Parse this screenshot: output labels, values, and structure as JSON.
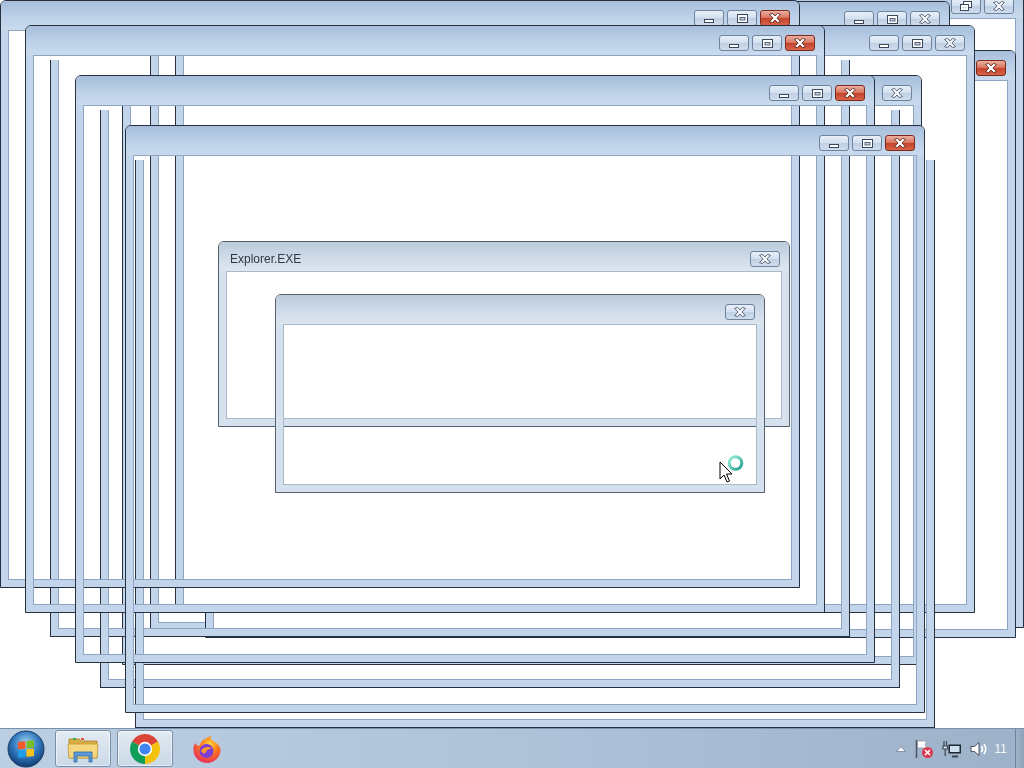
{
  "desktop": {
    "windows": [
      {
        "kind": "window",
        "active": false,
        "buttons": [
          {
            "kind": "restore"
          },
          {
            "kind": "close"
          }
        ]
      },
      {
        "kind": "window",
        "active": false,
        "buttons": [
          {
            "kind": "minimize"
          },
          {
            "kind": "maximize"
          },
          {
            "kind": "close"
          }
        ]
      },
      {
        "kind": "window",
        "active": true,
        "buttons": [
          {
            "kind": "close"
          }
        ]
      },
      {
        "kind": "window",
        "active": false,
        "buttons": [
          {
            "kind": "minimize"
          },
          {
            "kind": "maximize"
          },
          {
            "kind": "close"
          }
        ]
      },
      {
        "kind": "window",
        "active": false,
        "buttons": [
          {
            "kind": "close"
          }
        ]
      },
      {
        "kind": "frame"
      },
      {
        "kind": "frame"
      },
      {
        "kind": "frame"
      },
      {
        "kind": "window",
        "active": true,
        "buttons": [
          {
            "kind": "minimize"
          },
          {
            "kind": "maximize"
          },
          {
            "kind": "close"
          }
        ]
      },
      {
        "kind": "window",
        "active": true,
        "buttons": [
          {
            "kind": "minimize"
          },
          {
            "kind": "maximize"
          },
          {
            "kind": "close"
          }
        ]
      },
      {
        "kind": "window",
        "active": true,
        "buttons": [
          {
            "kind": "minimize"
          },
          {
            "kind": "maximize"
          },
          {
            "kind": "close"
          }
        ]
      },
      {
        "kind": "window",
        "active": true,
        "buttons": [
          {
            "kind": "minimize"
          },
          {
            "kind": "maximize"
          },
          {
            "kind": "close"
          }
        ]
      }
    ],
    "dialogs": [
      {
        "title": "Explorer.EXE",
        "active": false
      },
      {
        "active": false
      }
    ]
  },
  "taskbar": {
    "items": [
      {
        "running": true
      },
      {
        "running": true
      },
      {
        "running": false
      }
    ],
    "clock": "11"
  }
}
